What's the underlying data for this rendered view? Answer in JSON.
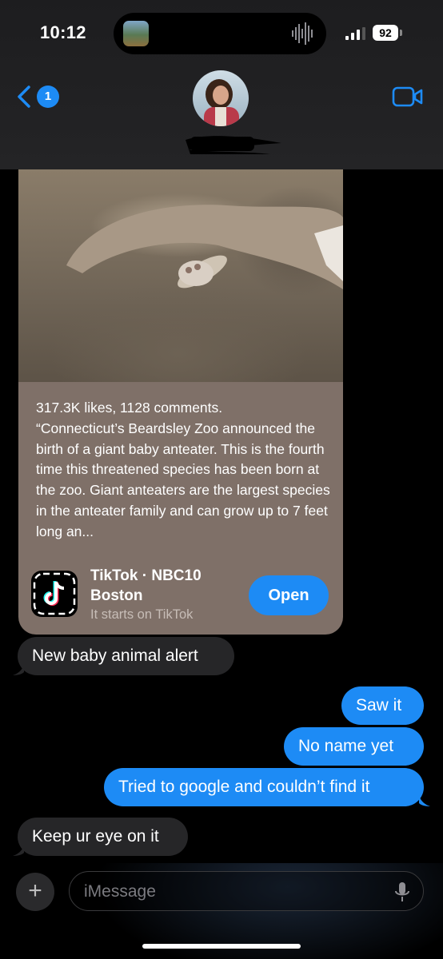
{
  "status_bar": {
    "time": "10:12",
    "battery": "92"
  },
  "header": {
    "back_badge": "1"
  },
  "card": {
    "caption": "317.3K likes, 1128 comments.\n“Connecticut’s Beardsley Zoo announced the birth of a giant baby anteater. This is the fourth time this threatened species has been born at the zoo.  Giant anteaters are the largest species in the anteater family and can grow up to 7 feet long an...",
    "source_title": "TikTok · NBC10\nBoston",
    "source_subtitle": "It starts on TikTok",
    "open_label": "Open"
  },
  "messages": [
    {
      "direction": "received",
      "text": "New baby animal alert"
    },
    {
      "direction": "sent",
      "text": "Saw it"
    },
    {
      "direction": "sent",
      "text": "No name yet"
    },
    {
      "direction": "sent",
      "text": "Tried to google and couldn’t find it"
    },
    {
      "direction": "received",
      "text": "Keep ur eye on it"
    }
  ],
  "input": {
    "placeholder": "iMessage"
  },
  "colors": {
    "accent": "#1d8bf5",
    "received_bubble": "#262628",
    "card_bg": "#7f7068"
  },
  "icons": [
    "back-chevron-icon",
    "video-camera-icon",
    "plus-icon",
    "microphone-icon",
    "tiktok-logo-icon",
    "signal-icon",
    "battery-icon"
  ]
}
